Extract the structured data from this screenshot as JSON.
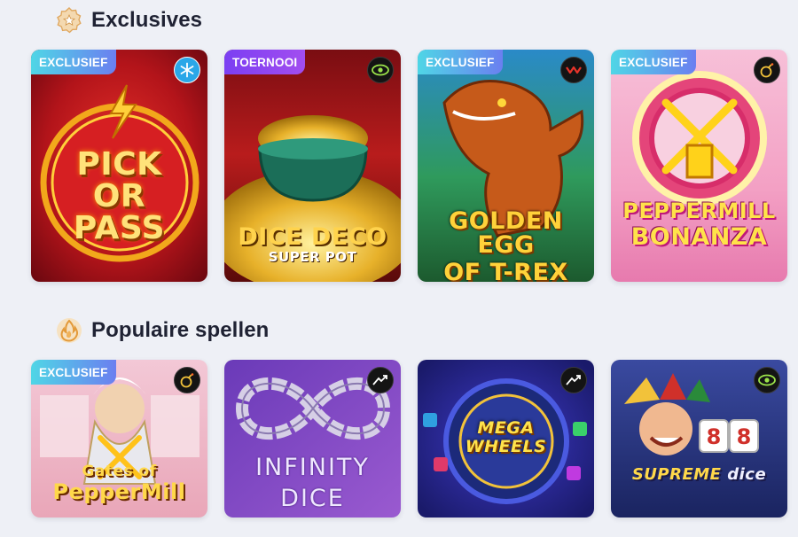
{
  "sections": [
    {
      "title": "Exclusives",
      "icon": "star-badge-icon",
      "games": [
        {
          "badge": "EXCLUSIEF",
          "badge_type": "exclusive",
          "provider_icon": "provider-snowflake-icon",
          "art_title_lines": [
            "PICK",
            "OR",
            "PASS"
          ]
        },
        {
          "badge": "TOERNOOI",
          "badge_type": "tournament",
          "provider_icon": "provider-eye-icon",
          "art_title_lines": [
            "DICE DECO",
            "SUPER POT"
          ]
        },
        {
          "badge": "EXCLUSIEF",
          "badge_type": "exclusive",
          "provider_icon": "provider-wave-icon",
          "art_title_lines": [
            "GOLDEN EGG",
            "OF T-REX"
          ]
        },
        {
          "badge": "EXCLUSIEF",
          "badge_type": "exclusive",
          "provider_icon": "provider-bomb-icon",
          "art_title_lines": [
            "PEPPERMILL",
            "BONANZA"
          ]
        }
      ]
    },
    {
      "title": "Populaire spellen",
      "icon": "flame-icon",
      "games": [
        {
          "badge": "EXCLUSIEF",
          "badge_type": "exclusive",
          "provider_icon": "provider-bomb-icon",
          "art_title_lines": [
            "Gates of",
            "PepperMill"
          ]
        },
        {
          "badge": "",
          "badge_type": "",
          "provider_icon": "provider-arrow-icon",
          "art_title_lines": [
            "INFINITY",
            "DICE"
          ]
        },
        {
          "badge": "",
          "badge_type": "",
          "provider_icon": "provider-arrow-icon",
          "art_title_lines": [
            "MEGA",
            "WHEELS"
          ]
        },
        {
          "badge": "",
          "badge_type": "",
          "provider_icon": "provider-eye-icon",
          "art_title_lines": [
            "SUPREME",
            "dice"
          ]
        }
      ]
    }
  ],
  "colors": {
    "page_bg": "#eef0f6",
    "exclusive_badge": "#4fd6e6",
    "tournament_badge": "#7b3ff2"
  }
}
